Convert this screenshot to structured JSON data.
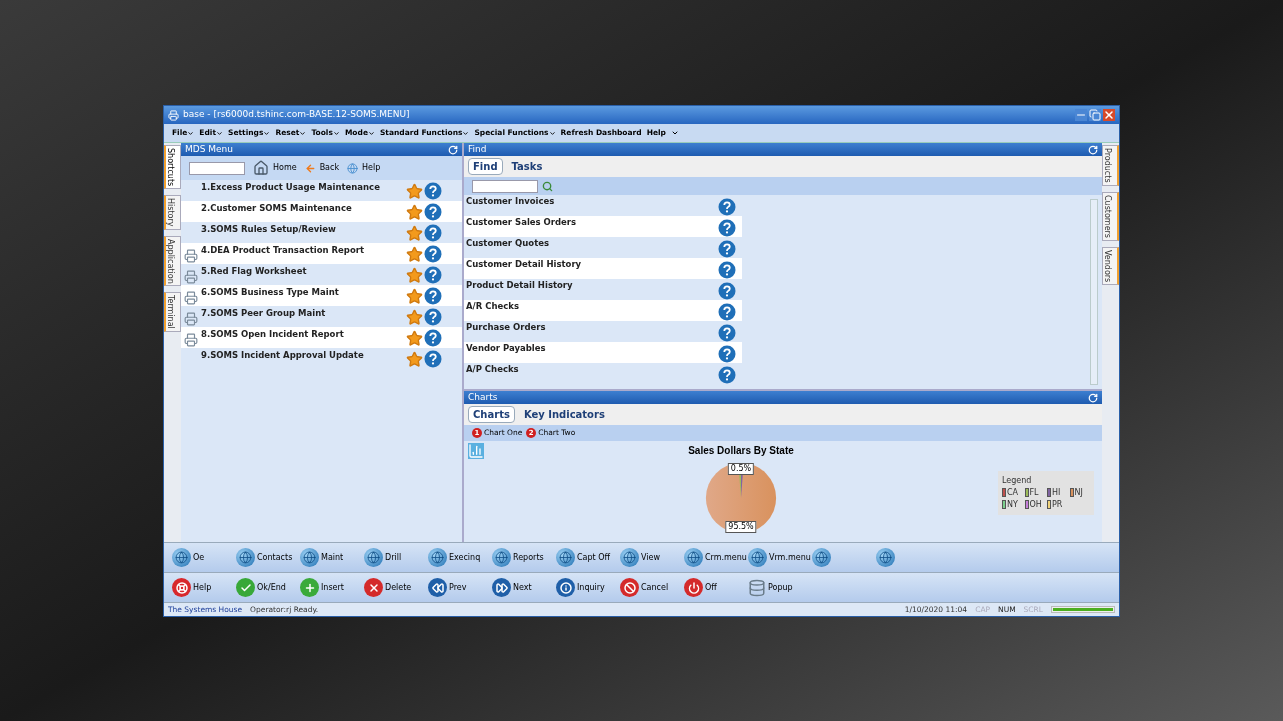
{
  "window": {
    "title": "base - [rs6000d.tshinc.com-BASE.12-SOMS.MENU]"
  },
  "menu": [
    {
      "label": "File",
      "dropdown": true
    },
    {
      "label": "Edit",
      "dropdown": true
    },
    {
      "label": "Settings",
      "dropdown": true
    },
    {
      "label": "Reset",
      "dropdown": true
    },
    {
      "label": "Tools",
      "dropdown": true
    },
    {
      "label": "Mode",
      "dropdown": true
    },
    {
      "label": "Standard Functions",
      "dropdown": true
    },
    {
      "label": "Special Functions",
      "dropdown": true
    },
    {
      "label": "Refresh Dashboard",
      "dropdown": false
    },
    {
      "label": "Help",
      "dropdown": false
    }
  ],
  "left_tabs": [
    {
      "label": "Shortcuts",
      "selected": true
    },
    {
      "label": "History",
      "selected": false
    },
    {
      "label": "Application",
      "selected": false
    },
    {
      "label": "Terminal",
      "selected": false
    }
  ],
  "right_tabs": [
    {
      "label": "Products",
      "selected": false
    },
    {
      "label": "Customers",
      "selected": false
    },
    {
      "label": "Vendors",
      "selected": false
    }
  ],
  "mds_menu": {
    "title": "MDS Menu",
    "nav": [
      "Home",
      "Back",
      "Help"
    ],
    "items": [
      {
        "label": "1.Excess Product Usage Maintenance",
        "printable": false
      },
      {
        "label": "2.Customer SOMS Maintenance",
        "printable": false
      },
      {
        "label": "3.SOMS Rules Setup/Review",
        "printable": false
      },
      {
        "label": "4.DEA Product Transaction Report",
        "printable": true
      },
      {
        "label": "5.Red Flag Worksheet",
        "printable": true
      },
      {
        "label": "6.SOMS Business Type Maint",
        "printable": true
      },
      {
        "label": "7.SOMS Peer Group Maint",
        "printable": true
      },
      {
        "label": "8.SOMS Open Incident Report",
        "printable": true
      },
      {
        "label": "9.SOMS Incident Approval Update",
        "printable": false
      }
    ]
  },
  "find": {
    "title": "Find",
    "tabs": [
      {
        "label": "Find",
        "selected": true
      },
      {
        "label": "Tasks",
        "selected": false
      }
    ],
    "items": [
      "Customer Invoices",
      "Customer Sales Orders",
      "Customer Quotes",
      "Customer Detail History",
      "Product Detail History",
      "A/R Checks",
      "Purchase Orders",
      "Vendor Payables",
      "A/P Checks"
    ]
  },
  "charts": {
    "title": "Charts",
    "tabs": [
      {
        "label": "Charts",
        "selected": true
      },
      {
        "label": "Key Indicators",
        "selected": false
      }
    ],
    "chart_buttons": [
      {
        "badge": "1",
        "label": "Chart One"
      },
      {
        "badge": "2",
        "label": "Chart Two"
      }
    ],
    "chart_title": "Sales Dollars By State",
    "slice_labels": [
      "0.5%",
      "95.5%"
    ],
    "legend_title": "Legend",
    "legend": [
      {
        "label": "CA",
        "color": "#c0504d"
      },
      {
        "label": "FL",
        "color": "#9bbb59"
      },
      {
        "label": "HI",
        "color": "#8064a2"
      },
      {
        "label": "NJ",
        "color": "#d9925e"
      },
      {
        "label": "NY",
        "color": "#7cd08e"
      },
      {
        "label": "OH",
        "color": "#c47fd8"
      },
      {
        "label": "PR",
        "color": "#efd27a"
      }
    ]
  },
  "function_bar": [
    {
      "kind": "globe",
      "label": "Oe"
    },
    {
      "kind": "globe",
      "label": "Contacts"
    },
    {
      "kind": "globe",
      "label": "Maint"
    },
    {
      "kind": "globe",
      "label": "Drill"
    },
    {
      "kind": "globe",
      "label": "Execinq"
    },
    {
      "kind": "globe",
      "label": "Reports"
    },
    {
      "kind": "globe",
      "label": "Capt Off"
    },
    {
      "kind": "globe",
      "label": "View"
    },
    {
      "kind": "globe",
      "label": "Crm.menu"
    },
    {
      "kind": "globe",
      "label": "Vrm.menu"
    },
    {
      "kind": "globe"
    },
    {
      "kind": "globe"
    }
  ],
  "action_bar": [
    {
      "kind": "help",
      "label": "Help"
    },
    {
      "kind": "ok",
      "label": "Ok/End"
    },
    {
      "kind": "insert",
      "label": "Insert"
    },
    {
      "kind": "delete",
      "label": "Delete"
    },
    {
      "kind": "prev",
      "label": "Prev"
    },
    {
      "kind": "next",
      "label": "Next"
    },
    {
      "kind": "inquiry",
      "label": "Inquiry"
    },
    {
      "kind": "cancel",
      "label": "Cancel"
    },
    {
      "kind": "off",
      "label": "Off"
    },
    {
      "kind": "popup",
      "label": "Popup"
    }
  ],
  "status_bar": {
    "company": "The Systems House",
    "message": "Operator:rj Ready.",
    "datetime": "1/10/2020 11:04",
    "indicators": [
      {
        "label": "CAP",
        "on": false
      },
      {
        "label": "NUM",
        "on": true
      },
      {
        "label": "SCRL",
        "on": false
      }
    ],
    "level": 1
  }
}
